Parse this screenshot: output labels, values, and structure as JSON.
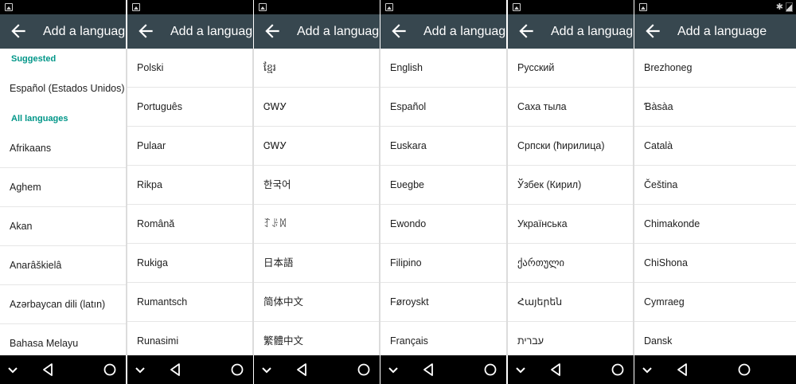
{
  "title": "Add a language",
  "panels": [
    {
      "status": {
        "bluetooth": false
      },
      "rows": [
        {
          "kind": "header",
          "text": "Suggested"
        },
        {
          "kind": "item",
          "text": "Español (Estados Unidos)"
        },
        {
          "kind": "header",
          "text": "All languages"
        },
        {
          "kind": "item",
          "text": "Afrikaans"
        },
        {
          "kind": "item",
          "text": "Aghem"
        },
        {
          "kind": "item",
          "text": "Akan"
        },
        {
          "kind": "item",
          "text": "Anarâškielâ"
        },
        {
          "kind": "item",
          "text": "Azərbaycan dili (latın)"
        },
        {
          "kind": "item",
          "text": "Bahasa Melayu"
        }
      ]
    },
    {
      "status": {
        "bluetooth": false
      },
      "rows": [
        {
          "kind": "item",
          "text": "Polski"
        },
        {
          "kind": "item",
          "text": "Português"
        },
        {
          "kind": "item",
          "text": "Pulaar"
        },
        {
          "kind": "item",
          "text": "Rikpa"
        },
        {
          "kind": "item",
          "text": "Română"
        },
        {
          "kind": "item",
          "text": "Rukiga"
        },
        {
          "kind": "item",
          "text": "Rumantsch"
        },
        {
          "kind": "item",
          "text": "Runasimi"
        }
      ]
    },
    {
      "status": {
        "bluetooth": false
      },
      "rows": [
        {
          "kind": "item",
          "text": "ខ្មែរ"
        },
        {
          "kind": "item",
          "text": "ᏣᎳᎩ"
        },
        {
          "kind": "item",
          "text": "ᏣᎳᎩ"
        },
        {
          "kind": "item",
          "text": "한국어"
        },
        {
          "kind": "item",
          "text": "ꆈꌠꉙ"
        },
        {
          "kind": "item",
          "text": "日本語"
        },
        {
          "kind": "item",
          "text": "简体中文"
        },
        {
          "kind": "item",
          "text": "繁體中文"
        }
      ]
    },
    {
      "status": {
        "bluetooth": false
      },
      "rows": [
        {
          "kind": "item",
          "text": "English"
        },
        {
          "kind": "item",
          "text": "Español"
        },
        {
          "kind": "item",
          "text": "Euskara"
        },
        {
          "kind": "item",
          "text": "Eʋegbe"
        },
        {
          "kind": "item",
          "text": "Ewondo"
        },
        {
          "kind": "item",
          "text": "Filipino"
        },
        {
          "kind": "item",
          "text": "Føroyskt"
        },
        {
          "kind": "item",
          "text": "Français"
        }
      ]
    },
    {
      "status": {
        "bluetooth": false
      },
      "rows": [
        {
          "kind": "item",
          "text": "Русский"
        },
        {
          "kind": "item",
          "text": "Саха тыла"
        },
        {
          "kind": "item",
          "text": "Српски (ћирилица)"
        },
        {
          "kind": "item",
          "text": "Ўзбек (Кирил)"
        },
        {
          "kind": "item",
          "text": "Українська"
        },
        {
          "kind": "item",
          "text": "ქართული"
        },
        {
          "kind": "item",
          "text": "Հայերեն"
        },
        {
          "kind": "item",
          "text": "עברית"
        }
      ]
    },
    {
      "status": {
        "bluetooth": true
      },
      "rows": [
        {
          "kind": "item",
          "text": "Brezhoneg"
        },
        {
          "kind": "item",
          "text": "Ɓàsàa"
        },
        {
          "kind": "item",
          "text": "Català"
        },
        {
          "kind": "item",
          "text": "Čeština"
        },
        {
          "kind": "item",
          "text": "Chimakonde"
        },
        {
          "kind": "item",
          "text": "ChiShona"
        },
        {
          "kind": "item",
          "text": "Cymraeg"
        },
        {
          "kind": "item",
          "text": "Dansk"
        }
      ]
    }
  ],
  "colors": {
    "toolbar": "#37474f",
    "accent": "#009688",
    "status_bar": "#000000",
    "nav_bar": "#000000"
  },
  "icons": {
    "back": "arrow-left-icon",
    "nav": [
      "chevron-down-icon",
      "triangle-back-icon",
      "circle-home-icon"
    ]
  }
}
